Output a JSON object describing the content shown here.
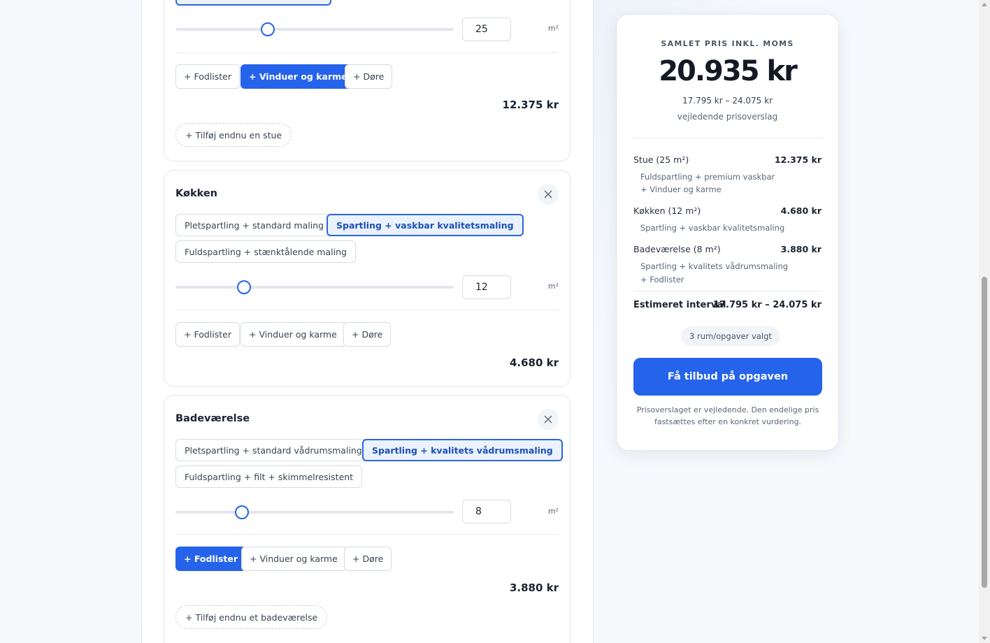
{
  "top_card": {
    "area_value": "25",
    "unit": "m²",
    "addons": [
      "+ Fodlister",
      "+ Vinduer og karme",
      "+ Døre"
    ],
    "price": "12.375 kr",
    "add_more": "+ Tilføj endnu en stue"
  },
  "kitchen": {
    "title": "Køkken",
    "options": [
      "Pletspartling + standard maling",
      "Spartling + vaskbar kvalitetsmaling",
      "Fuldspartling + stænktålende maling"
    ],
    "area_value": "12",
    "unit": "m²",
    "addons": [
      "+ Fodlister",
      "+ Vinduer og karme",
      "+ Døre"
    ],
    "price": "4.680 kr"
  },
  "bathroom": {
    "title": "Badeværelse",
    "options": [
      "Pletspartling + standard vådrumsmaling",
      "Spartling + kvalitets vådrumsmaling",
      "Fuldspartling + filt + skimmelresistent"
    ],
    "area_value": "8",
    "unit": "m²",
    "addons": [
      "+ Fodlister",
      "+ Vinduer og karme",
      "+ Døre"
    ],
    "price": "3.880 kr",
    "add_more": "+ Tilføj endnu et badeværelse"
  },
  "summary": {
    "label": "SAMLET PRIS INKL. MOMS",
    "total": "20.935 kr",
    "range": "17.795 kr – 24.075 kr",
    "note": "vejledende prisoverslag",
    "rows": [
      {
        "name": "Stue (25 m²)",
        "price": "12.375 kr",
        "details": [
          "Fuldspartling + premium vaskbar",
          "+ Vinduer og karme"
        ]
      },
      {
        "name": "Køkken (12 m²)",
        "price": "4.680 kr",
        "details": [
          "Spartling + vaskbar kvalitetsmaling"
        ]
      },
      {
        "name": "Badeværelse (8 m²)",
        "price": "3.880 kr",
        "details": [
          "Spartling + kvalitets vådrumsmaling",
          "+ Fodlister"
        ]
      }
    ],
    "estimate_label": "Estimeret interval",
    "estimate_value": "17.795 kr – 24.075 kr",
    "badge": "3 rum/opgaver valgt",
    "cta": "Få tilbud på opgaven",
    "disclaimer_1": "Prisoverslaget er vejledende. Den endelige pris",
    "disclaimer_2": "fastsættes efter en konkret vurdering."
  },
  "colors": {
    "accent": "#2563eb",
    "selected_bg": "#eaf2fd"
  }
}
